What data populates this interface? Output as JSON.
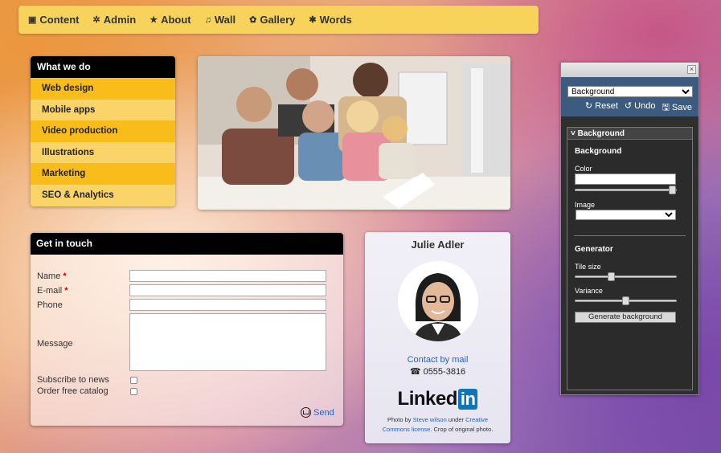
{
  "nav": [
    {
      "icon": "▣",
      "label": "Content"
    },
    {
      "icon": "✲",
      "label": "Admin"
    },
    {
      "icon": "★",
      "label": "About"
    },
    {
      "icon": "♫",
      "label": "Wall"
    },
    {
      "icon": "✿",
      "label": "Gallery"
    },
    {
      "icon": "✱",
      "label": "Words"
    }
  ],
  "services": {
    "title": "What we do",
    "items": [
      "Web design",
      "Mobile apps",
      "Video production",
      "Illustrations",
      "Marketing",
      "SEO & Analytics"
    ]
  },
  "contact": {
    "title": "Get in touch",
    "name_label": "Name",
    "email_label": "E-mail",
    "required_mark": "*",
    "phone_label": "Phone",
    "message_label": "Message",
    "subscribe_label": "Subscribe to news",
    "catalog_label": "Order free catalog",
    "send_label": "Send"
  },
  "profile": {
    "name": "Julie Adler",
    "mail_link": "Contact by mail",
    "phone": "☎ 0555-3816",
    "linkedin_word": "Linked",
    "linkedin_in": "in",
    "credit_prefix": "Photo by ",
    "credit_author": "Steve wilson",
    "credit_mid": " under ",
    "credit_license": "Creative Commons license",
    "credit_suffix": ". Crop of original photo."
  },
  "panel": {
    "close": "×",
    "selector_value": "Background",
    "reset": "↻ Reset",
    "undo": "↺ Undo",
    "save": "🖫 Save",
    "section_title": "˅ Background",
    "subsection": "Background",
    "color_label": "Color",
    "image_label": "Image",
    "generator_label": "Generator",
    "tile_size_label": "Tile size",
    "variance_label": "Variance",
    "generate_button": "Generate background",
    "color_slider_value": 1.0,
    "tile_size_value": 0.35,
    "variance_value": 0.5
  }
}
